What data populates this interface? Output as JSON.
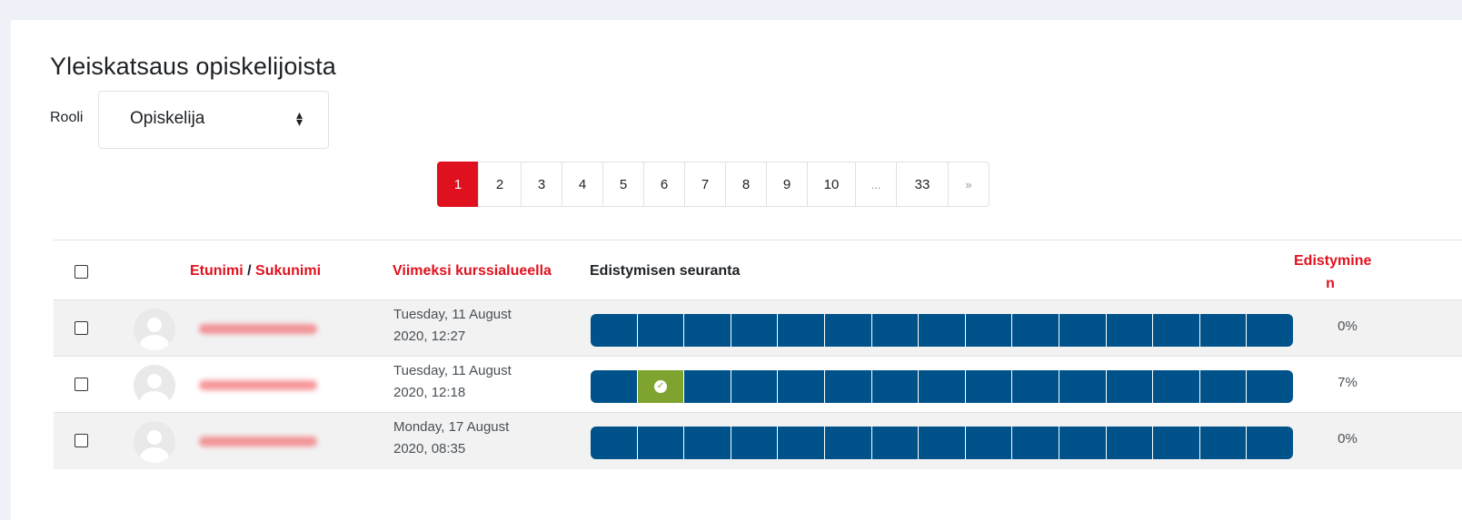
{
  "heading": "Yleiskatsaus opiskelijoista",
  "role": {
    "label": "Rooli",
    "selected": "Opiskelija"
  },
  "pagination": [
    "1",
    "2",
    "3",
    "4",
    "5",
    "6",
    "7",
    "8",
    "9",
    "10",
    "...",
    "33",
    "»"
  ],
  "pagination_current": "1",
  "table": {
    "columns": {
      "firstname": "Etunimi",
      "separator": " / ",
      "lastname": "Sukunimi",
      "last_access": "Viimeksi kurssialueella",
      "tracking": "Edistymisen seuranta",
      "progress_line1": "Edistymine",
      "progress_line2": "n"
    },
    "rows": [
      {
        "last_access_line1": "Tuesday, 11 August",
        "last_access_line2": "2020, 12:27",
        "progress": "0%",
        "completed_segments": []
      },
      {
        "last_access_line1": "Tuesday, 11 August",
        "last_access_line2": "2020, 12:18",
        "progress": "7%",
        "completed_segments": [
          1
        ]
      },
      {
        "last_access_line1": "Monday, 17 August",
        "last_access_line2": "2020, 08:35",
        "progress": "0%",
        "completed_segments": []
      }
    ]
  },
  "colors": {
    "accent": "#e0111e",
    "bar": "#00538a",
    "complete": "#7ea42f"
  }
}
